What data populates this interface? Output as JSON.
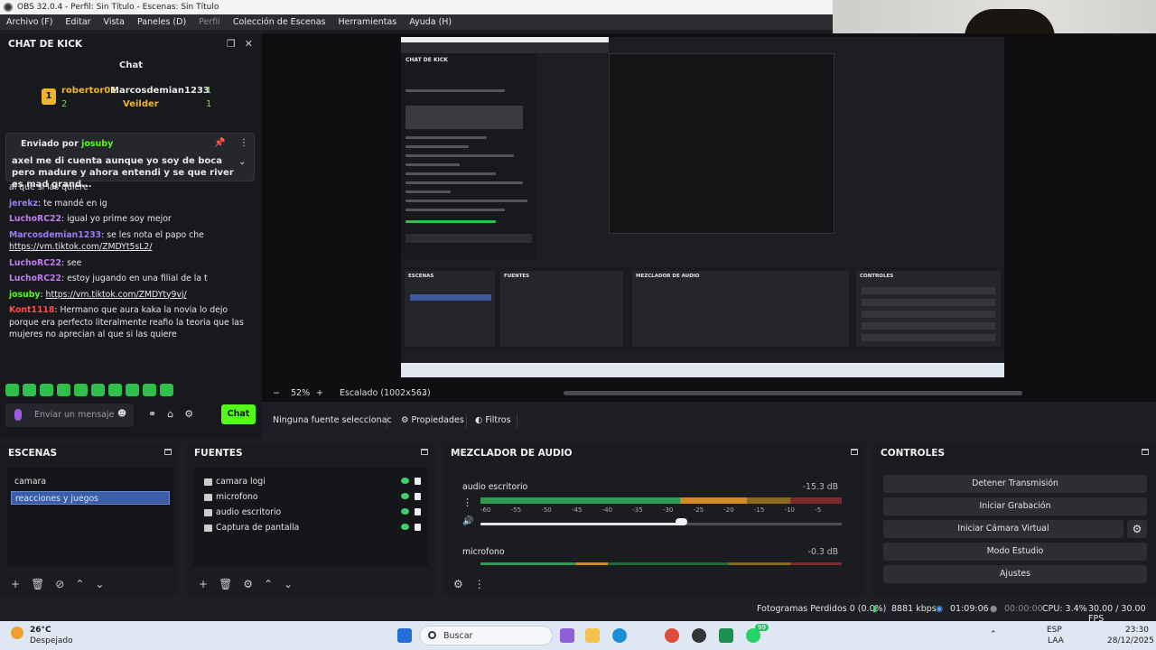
{
  "window": {
    "title": "OBS 32.0.4 - Perfil: Sin Título - Escenas: Sin Título"
  },
  "menu": [
    {
      "label": "Archivo (F)",
      "dim": false
    },
    {
      "label": "Editar",
      "dim": false
    },
    {
      "label": "Vista",
      "dim": false
    },
    {
      "label": "Paneles (D)",
      "dim": false
    },
    {
      "label": "Perfil",
      "dim": true
    },
    {
      "label": "Colección de Escenas",
      "dim": false
    },
    {
      "label": "Herramientas",
      "dim": false
    },
    {
      "label": "Ayuda (H)",
      "dim": false
    }
  ],
  "chat": {
    "dock_title": "CHAT DE KICK",
    "header": "Chat",
    "leaderboard": {
      "rank": "1",
      "first_user": "robertor01",
      "first_count": "2",
      "second_user": "Marcosdemian1233",
      "second_count": "1",
      "third_user": "Veilder",
      "third_count": "1"
    },
    "pinned": {
      "by_label": "Enviado por",
      "by_user": "josuby",
      "message": "axel me di cuenta aunque yo soy de boca pero madure y ahora entendi y se que river es mad grand..."
    },
    "messages": [
      {
        "user": "",
        "color": "#e6e6e6",
        "text": "al que si las quiere",
        "link": ""
      },
      {
        "user": "jerekz",
        "color": "#9b7cf2",
        "text": "te mandé en ig",
        "link": ""
      },
      {
        "user": "LuchoRC22",
        "color": "#c07cf2",
        "text": "igual yo prime soy mejor",
        "link": ""
      },
      {
        "user": "Marcosdemian1233",
        "color": "#9b7cf2",
        "text": "se les nota el papo che",
        "link": "https://vm.tiktok.com/ZMDYt5sL2/"
      },
      {
        "user": "LuchoRC22",
        "color": "#c07cf2",
        "text": "see",
        "link": ""
      },
      {
        "user": "LuchoRC22",
        "color": "#c07cf2",
        "text": "estoy jugando en una filial de la t",
        "link": ""
      },
      {
        "user": "josuby",
        "color": "#53fc18",
        "text": "",
        "link": "https://vm.tiktok.com/ZMDYty9vj/"
      },
      {
        "user": "Kont1118",
        "color": "#ff4b4b",
        "text": "Hermano que aura kaka la novia lo dejo porque era perfecto literalmente reafio la teoria que las mujeres no aprecian al que si las quiere",
        "link": ""
      }
    ],
    "input_placeholder": "Enviar un mensaje",
    "send_label": "Chat"
  },
  "preview": {
    "zoom": "52%",
    "scale_label": "Escalado (1002x563)"
  },
  "source_bar": {
    "no_source": "Ninguna fuente seleccionac",
    "properties": "Propiedades",
    "filters": "Filtros"
  },
  "scenes": {
    "title": "ESCENAS",
    "items": [
      {
        "label": "camara",
        "selected": false
      },
      {
        "label": "reacciones y juegos",
        "selected": true
      }
    ]
  },
  "sources": {
    "title": "FUENTES",
    "items": [
      {
        "label": "camara logi",
        "icon": "camera-icon"
      },
      {
        "label": "microfono",
        "icon": "microphone-icon"
      },
      {
        "label": "audio escritorio",
        "icon": "speaker-icon"
      },
      {
        "label": "Captura de pantalla",
        "icon": "monitor-icon"
      }
    ]
  },
  "mixer": {
    "title": "MEZCLADOR DE AUDIO",
    "channels": [
      {
        "name": "audio escritorio",
        "db": "-15.3 dB",
        "level": 0.73,
        "volume": 0.55
      },
      {
        "name": "microfono",
        "db": "-0.3 dB",
        "level": 0.35,
        "volume": 0.0
      }
    ],
    "ticks": [
      "-60",
      "-55",
      "-50",
      "-45",
      "-40",
      "-35",
      "-30",
      "-25",
      "-20",
      "-15",
      "-10",
      "-5",
      "0"
    ]
  },
  "controls": {
    "title": "CONTROLES",
    "buttons": [
      "Detener Transmisión",
      "Iniciar Grabación",
      "Iniciar Cámara Virtual",
      "Modo Estudio",
      "Ajustes"
    ]
  },
  "status": {
    "dropped": "Fotogramas Perdidos 0 (0.0%)",
    "bitrate": "8881 kbps",
    "stream_time": "01:09:06",
    "rec_time": "00:00:00",
    "cpu": "CPU: 3.4%",
    "fps": "30.00 / 30.00 FPS"
  },
  "taskbar": {
    "weather_temp": "26°C",
    "weather_desc": "Despejado",
    "search_label": "Buscar",
    "lang": "ESP",
    "lang2": "LAA",
    "time": "23:30",
    "date": "28/12/2025",
    "badge": "99"
  }
}
